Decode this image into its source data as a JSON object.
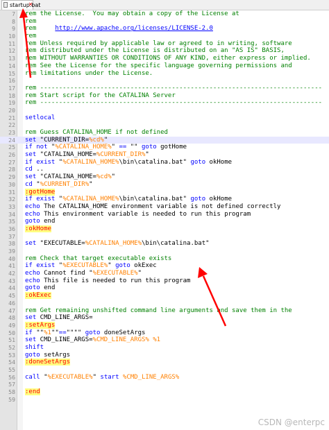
{
  "tab": {
    "label": "startup.bat"
  },
  "lines": [
    {
      "n": "7",
      "tokens": [
        {
          "c": "c",
          "t": "rem the License.  You may obtain a copy of the License at"
        }
      ]
    },
    {
      "n": "8",
      "tokens": [
        {
          "c": "c",
          "t": "rem"
        }
      ]
    },
    {
      "n": "9",
      "tokens": [
        {
          "c": "c",
          "t": "rem     "
        },
        {
          "c": "link",
          "t": "http://www.apache.org/licenses/LICENSE-2.0"
        }
      ]
    },
    {
      "n": "10",
      "tokens": [
        {
          "c": "c",
          "t": "rem"
        }
      ]
    },
    {
      "n": "11",
      "tokens": [
        {
          "c": "c",
          "t": "rem Unless required by applicable law or agreed to in writing, software"
        }
      ]
    },
    {
      "n": "12",
      "tokens": [
        {
          "c": "c",
          "t": "rem distributed under the License is distributed on an \"AS IS\" BASIS,"
        }
      ]
    },
    {
      "n": "13",
      "tokens": [
        {
          "c": "c",
          "t": "rem WITHOUT WARRANTIES OR CONDITIONS OF ANY KIND, either express or implied."
        }
      ]
    },
    {
      "n": "14",
      "tokens": [
        {
          "c": "c",
          "t": "rem See the License for the specific language governing permissions and"
        }
      ]
    },
    {
      "n": "15",
      "tokens": [
        {
          "c": "c",
          "t": "rem limitations under the License."
        }
      ]
    },
    {
      "n": "16",
      "tokens": []
    },
    {
      "n": "17",
      "tokens": [
        {
          "c": "c",
          "t": "rem ---------------------------------------------------------------------------"
        }
      ]
    },
    {
      "n": "18",
      "tokens": [
        {
          "c": "c",
          "t": "rem Start script for the CATALINA Server"
        }
      ]
    },
    {
      "n": "19",
      "tokens": [
        {
          "c": "c",
          "t": "rem ---------------------------------------------------------------------------"
        }
      ]
    },
    {
      "n": "20",
      "tokens": []
    },
    {
      "n": "21",
      "tokens": [
        {
          "c": "k",
          "t": "setlocal"
        }
      ]
    },
    {
      "n": "22",
      "tokens": []
    },
    {
      "n": "23",
      "tokens": [
        {
          "c": "c",
          "t": "rem Guess CATALINA_HOME if not defined"
        }
      ]
    },
    {
      "n": "24",
      "current": true,
      "tokens": [
        {
          "c": "k",
          "t": "set"
        },
        {
          "c": "t",
          "t": " \"CURRENT_DIR="
        },
        {
          "c": "v",
          "t": "%cd%"
        },
        {
          "c": "t",
          "t": "\""
        }
      ]
    },
    {
      "n": "25",
      "tokens": [
        {
          "c": "k",
          "t": "if not"
        },
        {
          "c": "t",
          "t": " \""
        },
        {
          "c": "v",
          "t": "%CATALINA_HOME%"
        },
        {
          "c": "t",
          "t": "\" "
        },
        {
          "c": "k",
          "t": "=="
        },
        {
          "c": "t",
          "t": " \"\" "
        },
        {
          "c": "k",
          "t": "goto"
        },
        {
          "c": "t",
          "t": " gotHome"
        }
      ]
    },
    {
      "n": "26",
      "tokens": [
        {
          "c": "k",
          "t": "set"
        },
        {
          "c": "t",
          "t": " \"CATALINA_HOME="
        },
        {
          "c": "v",
          "t": "%CURRENT_DIR%"
        },
        {
          "c": "t",
          "t": "\""
        }
      ]
    },
    {
      "n": "27",
      "tokens": [
        {
          "c": "k",
          "t": "if exist"
        },
        {
          "c": "t",
          "t": " \""
        },
        {
          "c": "v",
          "t": "%CATALINA_HOME%"
        },
        {
          "c": "t",
          "t": "\\bin\\catalina.bat\" "
        },
        {
          "c": "k",
          "t": "goto"
        },
        {
          "c": "t",
          "t": " okHome"
        }
      ]
    },
    {
      "n": "28",
      "tokens": [
        {
          "c": "k",
          "t": "cd"
        },
        {
          "c": "t",
          "t": " .."
        }
      ]
    },
    {
      "n": "29",
      "tokens": [
        {
          "c": "k",
          "t": "set"
        },
        {
          "c": "t",
          "t": " \"CATALINA_HOME="
        },
        {
          "c": "v",
          "t": "%cd%"
        },
        {
          "c": "t",
          "t": "\""
        }
      ]
    },
    {
      "n": "30",
      "tokens": [
        {
          "c": "k",
          "t": "cd"
        },
        {
          "c": "t",
          "t": " \""
        },
        {
          "c": "v",
          "t": "%CURRENT_DIR%"
        },
        {
          "c": "t",
          "t": "\""
        }
      ]
    },
    {
      "n": "31",
      "tokens": [
        {
          "c": "lbl",
          "t": ":gotHome"
        }
      ]
    },
    {
      "n": "32",
      "tokens": [
        {
          "c": "k",
          "t": "if exist"
        },
        {
          "c": "t",
          "t": " \""
        },
        {
          "c": "v",
          "t": "%CATALINA_HOME%"
        },
        {
          "c": "t",
          "t": "\\bin\\catalina.bat\" "
        },
        {
          "c": "k",
          "t": "goto"
        },
        {
          "c": "t",
          "t": " okHome"
        }
      ]
    },
    {
      "n": "33",
      "tokens": [
        {
          "c": "k",
          "t": "echo"
        },
        {
          "c": "t",
          "t": " The CATALINA_HOME environment variable is not defined correctly"
        }
      ]
    },
    {
      "n": "34",
      "tokens": [
        {
          "c": "k",
          "t": "echo"
        },
        {
          "c": "t",
          "t": " This environment variable is needed to run this program"
        }
      ]
    },
    {
      "n": "35",
      "tokens": [
        {
          "c": "k",
          "t": "goto"
        },
        {
          "c": "t",
          "t": " end"
        }
      ]
    },
    {
      "n": "36",
      "tokens": [
        {
          "c": "lbl",
          "t": ":okHome"
        }
      ]
    },
    {
      "n": "37",
      "tokens": []
    },
    {
      "n": "38",
      "tokens": [
        {
          "c": "k",
          "t": "set"
        },
        {
          "c": "t",
          "t": " \"EXECUTABLE="
        },
        {
          "c": "v",
          "t": "%CATALINA_HOME%"
        },
        {
          "c": "t",
          "t": "\\bin\\catalina.bat\""
        }
      ]
    },
    {
      "n": "39",
      "tokens": []
    },
    {
      "n": "40",
      "tokens": [
        {
          "c": "c",
          "t": "rem Check that target executable exists"
        }
      ]
    },
    {
      "n": "41",
      "tokens": [
        {
          "c": "k",
          "t": "if exist"
        },
        {
          "c": "t",
          "t": " \""
        },
        {
          "c": "v",
          "t": "%EXECUTABLE%"
        },
        {
          "c": "t",
          "t": "\" "
        },
        {
          "c": "k",
          "t": "goto"
        },
        {
          "c": "t",
          "t": " okExec"
        }
      ]
    },
    {
      "n": "42",
      "tokens": [
        {
          "c": "k",
          "t": "echo"
        },
        {
          "c": "t",
          "t": " Cannot find \""
        },
        {
          "c": "v",
          "t": "%EXECUTABLE%"
        },
        {
          "c": "t",
          "t": "\""
        }
      ]
    },
    {
      "n": "43",
      "tokens": [
        {
          "c": "k",
          "t": "echo"
        },
        {
          "c": "t",
          "t": " This file is needed to run this program"
        }
      ]
    },
    {
      "n": "44",
      "tokens": [
        {
          "c": "k",
          "t": "goto"
        },
        {
          "c": "t",
          "t": " end"
        }
      ]
    },
    {
      "n": "45",
      "tokens": [
        {
          "c": "lbl",
          "t": ":okExec"
        }
      ]
    },
    {
      "n": "46",
      "tokens": []
    },
    {
      "n": "47",
      "tokens": [
        {
          "c": "c",
          "t": "rem Get remaining unshifted command line arguments and save them in the"
        }
      ]
    },
    {
      "n": "48",
      "tokens": [
        {
          "c": "k",
          "t": "set"
        },
        {
          "c": "t",
          "t": " CMD_LINE_ARGS="
        }
      ]
    },
    {
      "n": "49",
      "tokens": [
        {
          "c": "lbl",
          "t": ":setArgs"
        }
      ]
    },
    {
      "n": "50",
      "tokens": [
        {
          "c": "k",
          "t": "if"
        },
        {
          "c": "t",
          "t": " \"\""
        },
        {
          "c": "v",
          "t": "%1"
        },
        {
          "c": "t",
          "t": "\"\""
        },
        {
          "c": "k",
          "t": "=="
        },
        {
          "c": "t",
          "t": "\"\"\"\" "
        },
        {
          "c": "k",
          "t": "goto"
        },
        {
          "c": "t",
          "t": " doneSetArgs"
        }
      ]
    },
    {
      "n": "51",
      "tokens": [
        {
          "c": "k",
          "t": "set"
        },
        {
          "c": "t",
          "t": " CMD_LINE_ARGS="
        },
        {
          "c": "v",
          "t": "%CMD_LINE_ARGS%"
        },
        {
          "c": "t",
          "t": " "
        },
        {
          "c": "v",
          "t": "%1"
        }
      ]
    },
    {
      "n": "52",
      "tokens": [
        {
          "c": "k",
          "t": "shift"
        }
      ]
    },
    {
      "n": "53",
      "tokens": [
        {
          "c": "k",
          "t": "goto"
        },
        {
          "c": "t",
          "t": " setArgs"
        }
      ]
    },
    {
      "n": "54",
      "tokens": [
        {
          "c": "lbl",
          "t": ":doneSetArgs"
        }
      ]
    },
    {
      "n": "55",
      "tokens": []
    },
    {
      "n": "56",
      "tokens": [
        {
          "c": "k",
          "t": "call"
        },
        {
          "c": "t",
          "t": " \""
        },
        {
          "c": "v",
          "t": "%EXECUTABLE%"
        },
        {
          "c": "t",
          "t": "\" "
        },
        {
          "c": "k",
          "t": "start"
        },
        {
          "c": "t",
          "t": " "
        },
        {
          "c": "v",
          "t": "%CMD_LINE_ARGS%"
        }
      ]
    },
    {
      "n": "57",
      "tokens": []
    },
    {
      "n": "58",
      "tokens": [
        {
          "c": "lbl",
          "t": ":end"
        }
      ]
    },
    {
      "n": "59",
      "tokens": []
    }
  ],
  "watermark": "CSDN @enterpc",
  "colors": {
    "comment": "#008000",
    "keyword": "#0000ff",
    "variable": "#ff8000",
    "label_bg": "#ffff80",
    "label_fg": "#ff0000",
    "arrow": "#ff0000",
    "current_line": "#e8e8ff"
  },
  "icons": [
    "file-icon",
    "close-icon",
    "arrow-annotation"
  ]
}
